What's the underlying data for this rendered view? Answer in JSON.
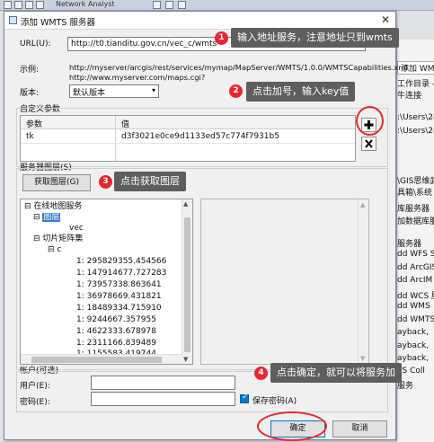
{
  "background": {
    "menu_text": "Network Analyst",
    "tab_label": "添加 WMTS",
    "lines": [
      "工作目录 -",
      "牛连接",
      ":\\Users\\24",
      ":\\Users\\24",
      "\\GIS思维武",
      "具箱\\系统",
      "库服务器",
      "加数据库服",
      "服务器",
      "dd WFS S",
      "dd ArcGIS",
      "dd ArcIM",
      "dd WCS 服",
      "dd WMS",
      "dd WMTS",
      "ayback,",
      "ayback,",
      "ayback,",
      "TS Coll",
      "服务"
    ]
  },
  "dialog": {
    "title": "添加 WMTS 服务器",
    "close_glyph": "✕",
    "url_label": "URL(U):",
    "url_value": "http://t0.tianditu.gov.cn/vec_c/wmts",
    "example_label": "示例:",
    "example_line1": "http://myserver/arcgis/rest/services/mymap/MapServer/WMTS/1.0.0/WMTSCapabilities.xml",
    "example_line2": "http://www.myserver.com/maps.cgi?",
    "version_label": "版本:",
    "version_value": "默认版本",
    "custom_params_label": "自定义参数",
    "params_col_param": "参数",
    "params_col_value": "值",
    "param_key": "tk",
    "param_value": "d3f3021e0ce9d1133ed57c774f7931b5",
    "add_icon": "plus-icon",
    "remove_icon": "close-icon",
    "server_layers_label": "服务器图层(S)",
    "get_layers_button": "获取图层(G)",
    "tree": {
      "root": "在线地图服务",
      "layer_folder": "图层",
      "layer_item": "vec",
      "matrix_folder": "切片矩阵集",
      "matrix_item": "c",
      "scales": [
        "1: 295829355.454566",
        "1: 147914677.727283",
        "1: 73957338.863641",
        "1: 36978669.431821",
        "1: 18489334.715910",
        "1: 9244667.357955",
        "1: 4622333.678978",
        "1: 2311166.839489",
        "1: 1155583.419744"
      ]
    },
    "account_label": "帐户(可选)",
    "user_label": "用户(E):",
    "password_label": "密码(E):",
    "save_password_label": "保存密码(A)",
    "ok_button": "确定",
    "cancel_button": "取消"
  },
  "annotations": [
    {
      "number": "1",
      "text": "输入地址服务，注意地址只到wmts"
    },
    {
      "number": "2",
      "text": "点击加号，输入key值"
    },
    {
      "number": "3",
      "text": "点击获取图层"
    },
    {
      "number": "4",
      "text": "点击确定，就可以将服务加"
    }
  ],
  "colors": {
    "callout_bg": "#5e5e5e",
    "marker_red": "#e8262d",
    "selection_blue": "#3b7bd6"
  }
}
